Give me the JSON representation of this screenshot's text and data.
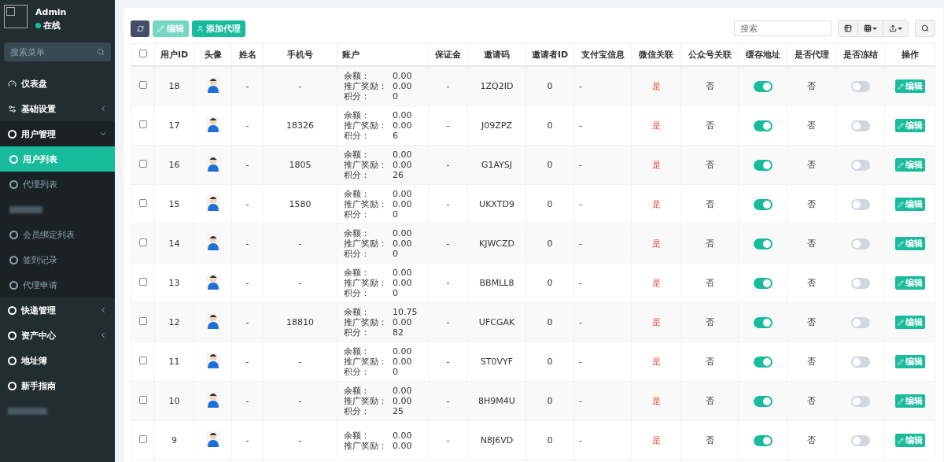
{
  "sidebar": {
    "user": {
      "name": "Admin",
      "status": "在线",
      "online": true
    },
    "search": {
      "placeholder": "搜索菜单"
    },
    "items": [
      {
        "label": "仪表盘",
        "kind": "dashboard",
        "expanded": false,
        "has_caret": false
      },
      {
        "label": "基础设置",
        "kind": "settings",
        "expanded": false,
        "has_caret": true
      },
      {
        "label": "用户管理",
        "kind": "circle",
        "expanded": true,
        "has_caret": true,
        "children": [
          {
            "label": "用户列表",
            "selected": true,
            "kind": "item"
          },
          {
            "label": "代理列表",
            "selected": false,
            "kind": "item"
          },
          {
            "kind": "redacted"
          },
          {
            "label": "会员绑定列表",
            "selected": false,
            "kind": "item"
          },
          {
            "label": "签到记录",
            "selected": false,
            "kind": "item"
          },
          {
            "label": "代理申请",
            "selected": false,
            "kind": "item"
          }
        ]
      },
      {
        "label": "快递管理",
        "kind": "circle",
        "expanded": false,
        "has_caret": true
      },
      {
        "label": "资产中心",
        "kind": "circle",
        "expanded": false,
        "has_caret": true
      },
      {
        "label": "地址簿",
        "kind": "circle",
        "expanded": false,
        "has_caret": false
      },
      {
        "label": "新手指南",
        "kind": "circle",
        "expanded": false,
        "has_caret": false
      },
      {
        "kind": "redacted"
      }
    ]
  },
  "toolbar": {
    "buttons": [
      {
        "kind": "refresh",
        "disabled": false
      },
      {
        "kind": "edit",
        "label": "编辑",
        "disabled": true
      },
      {
        "kind": "add",
        "label": "添加代理",
        "disabled": false
      }
    ],
    "search": {
      "placeholder": "搜索"
    }
  },
  "table": {
    "select_all_checked": false,
    "columns": [
      "用户ID",
      "头像",
      "姓名",
      "手机号",
      "账户",
      "保证金",
      "邀请码",
      "邀请者ID",
      "支付宝信息",
      "微信关联",
      "公众号关联",
      "缓存地址",
      "是否代理",
      "是否冻结",
      "操作"
    ],
    "rows": [
      {
        "checked": false,
        "id": "18",
        "name": "-",
        "phone": "-",
        "account": [
          {
            "label": "余额：",
            "value": "0.00"
          },
          {
            "label": "推广奖励：",
            "value": "0.00"
          },
          {
            "label": "积分：",
            "value": "0"
          }
        ],
        "deposit": "-",
        "invite_code": "1ZQ2ID",
        "inviter_id": "0",
        "alipay": "-",
        "wechat": {
          "text": "是",
          "linked": true
        },
        "official": {
          "text": "否",
          "linked": false
        },
        "cache_address": {
          "on": true
        },
        "agent": "否",
        "frozen": {
          "on": false
        },
        "action": "编辑"
      },
      {
        "checked": false,
        "id": "17",
        "name": "-",
        "phone": "18326",
        "account": [
          {
            "label": "余额：",
            "value": "0.00"
          },
          {
            "label": "推广奖励：",
            "value": "0.00"
          },
          {
            "label": "积分：",
            "value": "6"
          }
        ],
        "deposit": "-",
        "invite_code": "J09ZPZ",
        "inviter_id": "0",
        "alipay": "-",
        "wechat": {
          "text": "是",
          "linked": true
        },
        "official": {
          "text": "否",
          "linked": false
        },
        "cache_address": {
          "on": true
        },
        "agent": "否",
        "frozen": {
          "on": false
        },
        "action": "编辑"
      },
      {
        "checked": false,
        "id": "16",
        "name": "-",
        "phone": "1805",
        "account": [
          {
            "label": "余额：",
            "value": "0.00"
          },
          {
            "label": "推广奖励：",
            "value": "0.00"
          },
          {
            "label": "积分：",
            "value": "26"
          }
        ],
        "deposit": "-",
        "invite_code": "G1AYSJ",
        "inviter_id": "0",
        "alipay": "-",
        "wechat": {
          "text": "是",
          "linked": true
        },
        "official": {
          "text": "否",
          "linked": false
        },
        "cache_address": {
          "on": true
        },
        "agent": "否",
        "frozen": {
          "on": false
        },
        "action": "编辑"
      },
      {
        "checked": false,
        "id": "15",
        "name": "-",
        "phone": "1580",
        "account": [
          {
            "label": "余额：",
            "value": "0.00"
          },
          {
            "label": "推广奖励：",
            "value": "0.00"
          },
          {
            "label": "积分：",
            "value": "0"
          }
        ],
        "deposit": "-",
        "invite_code": "UKXTD9",
        "inviter_id": "0",
        "alipay": "-",
        "wechat": {
          "text": "是",
          "linked": true
        },
        "official": {
          "text": "否",
          "linked": false
        },
        "cache_address": {
          "on": true
        },
        "agent": "否",
        "frozen": {
          "on": false
        },
        "action": "编辑"
      },
      {
        "checked": false,
        "id": "14",
        "name": "-",
        "phone": "-",
        "account": [
          {
            "label": "余额：",
            "value": "0.00"
          },
          {
            "label": "推广奖励：",
            "value": "0.00"
          },
          {
            "label": "积分：",
            "value": "0"
          }
        ],
        "deposit": "-",
        "invite_code": "KJWCZD",
        "inviter_id": "0",
        "alipay": "-",
        "wechat": {
          "text": "是",
          "linked": true
        },
        "official": {
          "text": "否",
          "linked": false
        },
        "cache_address": {
          "on": true
        },
        "agent": "否",
        "frozen": {
          "on": false
        },
        "action": "编辑"
      },
      {
        "checked": false,
        "id": "13",
        "name": "-",
        "phone": "-",
        "account": [
          {
            "label": "余额：",
            "value": "0.00"
          },
          {
            "label": "推广奖励：",
            "value": "0.00"
          },
          {
            "label": "积分：",
            "value": "0"
          }
        ],
        "deposit": "-",
        "invite_code": "BBMLL8",
        "inviter_id": "0",
        "alipay": "-",
        "wechat": {
          "text": "是",
          "linked": true
        },
        "official": {
          "text": "否",
          "linked": false
        },
        "cache_address": {
          "on": true
        },
        "agent": "否",
        "frozen": {
          "on": false
        },
        "action": "编辑"
      },
      {
        "checked": false,
        "id": "12",
        "name": "-",
        "phone": "18810",
        "account": [
          {
            "label": "余额：",
            "value": "10.75"
          },
          {
            "label": "推广奖励：",
            "value": "0.00"
          },
          {
            "label": "积分：",
            "value": "82"
          }
        ],
        "deposit": "-",
        "invite_code": "UFCGAK",
        "inviter_id": "0",
        "alipay": "-",
        "wechat": {
          "text": "是",
          "linked": true
        },
        "official": {
          "text": "否",
          "linked": false
        },
        "cache_address": {
          "on": true
        },
        "agent": "否",
        "frozen": {
          "on": false
        },
        "action": "编辑"
      },
      {
        "checked": false,
        "id": "11",
        "name": "-",
        "phone": "-",
        "account": [
          {
            "label": "余额：",
            "value": "0.00"
          },
          {
            "label": "推广奖励：",
            "value": "0.00"
          },
          {
            "label": "积分：",
            "value": "0"
          }
        ],
        "deposit": "-",
        "invite_code": "ST0VYF",
        "inviter_id": "0",
        "alipay": "-",
        "wechat": {
          "text": "是",
          "linked": true
        },
        "official": {
          "text": "否",
          "linked": false
        },
        "cache_address": {
          "on": true
        },
        "agent": "否",
        "frozen": {
          "on": false
        },
        "action": "编辑"
      },
      {
        "checked": false,
        "id": "10",
        "name": "-",
        "phone": "-",
        "account": [
          {
            "label": "余额：",
            "value": "0.00"
          },
          {
            "label": "推广奖励：",
            "value": "0.00"
          },
          {
            "label": "积分：",
            "value": "25"
          }
        ],
        "deposit": "-",
        "invite_code": "8H9M4U",
        "inviter_id": "0",
        "alipay": "-",
        "wechat": {
          "text": "是",
          "linked": true
        },
        "official": {
          "text": "否",
          "linked": false
        },
        "cache_address": {
          "on": true
        },
        "agent": "否",
        "frozen": {
          "on": false
        },
        "action": "编辑"
      },
      {
        "checked": false,
        "id": "9",
        "name": "-",
        "phone": "-",
        "account": [
          {
            "label": "余额：",
            "value": "0.00"
          },
          {
            "label": "推广奖励：",
            "value": "0.00"
          }
        ],
        "deposit": "-",
        "invite_code": "N8J6VD",
        "inviter_id": "0",
        "alipay": "-",
        "wechat": {
          "text": "是",
          "linked": true
        },
        "official": {
          "text": "否",
          "linked": false
        },
        "cache_address": {
          "on": true
        },
        "agent": "否",
        "frozen": {
          "on": false
        },
        "action": "编辑"
      }
    ]
  }
}
